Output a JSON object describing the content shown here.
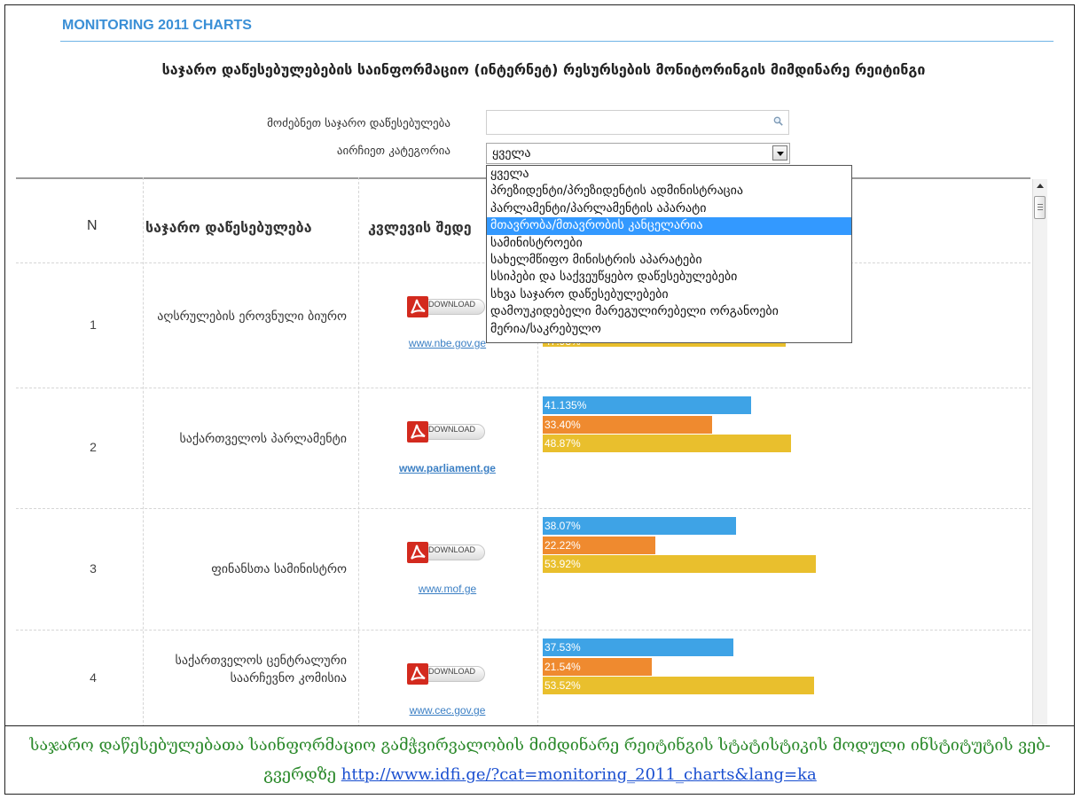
{
  "site_heading": "MONITORING 2011 CHARTS",
  "page_title": "საჯარო დაწესებულებების საინფორმაციო (ინტერნეტ) რესურსების მონიტორინგის მიმდინარე რეიტინგი",
  "filters": {
    "search_label": "მოძებნეთ საჯარო დაწესებულება",
    "search_value": "",
    "category_label": "აირჩიეთ კატეგორია",
    "category_selected": "ყველა",
    "category_options": [
      {
        "label": "ყველა",
        "highlighted": false
      },
      {
        "label": "პრეზიდენტი/პრეზიდენტის ადმინისტრაცია",
        "highlighted": false
      },
      {
        "label": "პარლამენტი/პარლამენტის აპარატი",
        "highlighted": false
      },
      {
        "label": "მთავრობა/მთავრობის კანცელარია",
        "highlighted": true
      },
      {
        "label": "სამინისტროები",
        "highlighted": false
      },
      {
        "label": "სახელმწიფო მინისტრის აპარატები",
        "highlighted": false
      },
      {
        "label": "სსიპები და საქვეუწყებო დაწესებულებები",
        "highlighted": false
      },
      {
        "label": "სხვა საჯარო დაწესებულებები",
        "highlighted": false
      },
      {
        "label": "დამოუკიდებელი მარეგულირებელი ორგანოები",
        "highlighted": false
      },
      {
        "label": "მერია/საკრებულო",
        "highlighted": false
      }
    ]
  },
  "table": {
    "headers": {
      "n": "N",
      "institution": "საჯარო დაწესებულება",
      "report": "კვლევის შედე"
    },
    "download_label": "DOWNLOAD",
    "rows": [
      {
        "n": "1",
        "name": "აღსრულების ეროვნული ბიურო",
        "link": "www.nbe.gov.ge",
        "bars": [
          null,
          null,
          "47.93%"
        ],
        "fractions": [
          null,
          null,
          0.4793
        ]
      },
      {
        "n": "2",
        "name": "საქართველოს პარლამენტი",
        "link": "www.parliament.ge",
        "bars": [
          "41.135%",
          "33.40%",
          "48.87%"
        ],
        "fractions": [
          0.41135,
          0.334,
          0.4887
        ]
      },
      {
        "n": "3",
        "name": "ფინანსთა სამინისტრო",
        "link": "www.mof.ge",
        "bars": [
          "38.07%",
          "22.22%",
          "53.92%"
        ],
        "fractions": [
          0.3807,
          0.2222,
          0.5392
        ]
      },
      {
        "n": "4",
        "name": "საქართველოს ცენტრალური საარჩევნო კომისია",
        "link": "www.cec.gov.ge",
        "bars": [
          "37.53%",
          "21.54%",
          "53.52%"
        ],
        "fractions": [
          0.3753,
          0.2154,
          0.5352
        ]
      }
    ]
  },
  "colors": {
    "accent": "#3a8fd6",
    "bar_series_1": "#3ea3e6",
    "bar_series_2": "#ef8a2f",
    "bar_series_3": "#e9bf2d",
    "caption": "#2c8a2c",
    "link": "#1a4fd0"
  },
  "caption": {
    "text": "საჯარო დაწესებულებათა საინფორმაციო გამჭვირვალობის მიმდინარე რეიტინგის სტატისტიკის მოდული ინსტიტუტის ვებ-გვერდზე ",
    "link": "http://www.idfi.ge/?cat=monitoring_2011_charts&lang=ka"
  }
}
